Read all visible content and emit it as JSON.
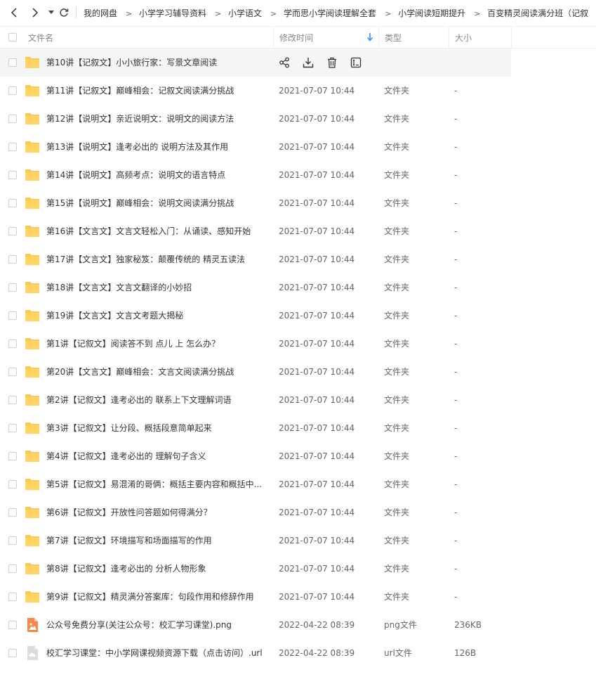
{
  "nav": {
    "breadcrumb": [
      "我的网盘",
      "小学学习辅导资料",
      "小学语文",
      "学而思小学阅读理解全套",
      "小学阅读短期提升",
      "百变精灵阅读满分班（记叙"
    ]
  },
  "columns": {
    "name": "文件名",
    "modified": "修改时间",
    "type": "类型",
    "size": "大小"
  },
  "colors": {
    "folder": "#FFC94D",
    "accent": "#3B8CFF"
  },
  "files": [
    {
      "icon": "folder-icon",
      "name": "第10讲【记叙文】小小旅行家：写景文章阅读",
      "time": "",
      "type": "",
      "size": "",
      "hover": true
    },
    {
      "icon": "folder-icon",
      "name": "第11讲【记叙文】巅峰相会：记叙文阅读满分挑战",
      "time": "2021-07-07 10:44",
      "type": "文件夹",
      "size": "-"
    },
    {
      "icon": "folder-icon",
      "name": "第12讲【说明文】亲近说明文：说明文的阅读方法",
      "time": "2021-07-07 10:44",
      "type": "文件夹",
      "size": "-"
    },
    {
      "icon": "folder-icon",
      "name": "第13讲【说明文】逢考必出的 说明方法及其作用",
      "time": "2021-07-07 10:44",
      "type": "文件夹",
      "size": "-"
    },
    {
      "icon": "folder-icon",
      "name": "第14讲【说明文】高频考点：说明文的语言特点",
      "time": "2021-07-07 10:44",
      "type": "文件夹",
      "size": "-"
    },
    {
      "icon": "folder-icon",
      "name": "第15讲【说明文】巅峰相会：说明文阅读满分挑战",
      "time": "2021-07-07 10:44",
      "type": "文件夹",
      "size": "-"
    },
    {
      "icon": "folder-icon",
      "name": "第16讲【文言文】文言文轻松入门：从诵读、感知开始",
      "time": "2021-07-07 10:44",
      "type": "文件夹",
      "size": "-"
    },
    {
      "icon": "folder-icon",
      "name": "第17讲【文言文】独家秘笈：颠覆传统的 精灵五读法",
      "time": "2021-07-07 10:44",
      "type": "文件夹",
      "size": "-"
    },
    {
      "icon": "folder-icon",
      "name": "第18讲【文言文】文言文翻译的小妙招",
      "time": "2021-07-07 10:44",
      "type": "文件夹",
      "size": "-"
    },
    {
      "icon": "folder-icon",
      "name": "第19讲【文言文】文言文考题大揭秘",
      "time": "2021-07-07 10:44",
      "type": "文件夹",
      "size": "-"
    },
    {
      "icon": "folder-icon",
      "name": "第1讲【记叙文】阅读答不到 点儿 上 怎么办？",
      "time": "2021-07-07 10:44",
      "type": "文件夹",
      "size": "-"
    },
    {
      "icon": "folder-icon",
      "name": "第20讲【文言文】巅峰相会：文言文阅读满分挑战",
      "time": "2021-07-07 10:44",
      "type": "文件夹",
      "size": "-"
    },
    {
      "icon": "folder-icon",
      "name": "第2讲【记叙文】逢考必出的 联系上下文理解词语",
      "time": "2021-07-07 10:44",
      "type": "文件夹",
      "size": "-"
    },
    {
      "icon": "folder-icon",
      "name": "第3讲【记叙文】让分段、概括段意简单起来",
      "time": "2021-07-07 10:44",
      "type": "文件夹",
      "size": "-"
    },
    {
      "icon": "folder-icon",
      "name": "第4讲【记叙文】逢考必出的 理解句子含义",
      "time": "2021-07-07 10:44",
      "type": "文件夹",
      "size": "-"
    },
    {
      "icon": "folder-icon",
      "name": "第5讲【记叙文】易混淆的哥俩：概括主要内容和概括中...",
      "time": "2021-07-07 10:44",
      "type": "文件夹",
      "size": "-"
    },
    {
      "icon": "folder-icon",
      "name": "第6讲【记叙文】开放性问答题如何得满分？",
      "time": "2021-07-07 10:44",
      "type": "文件夹",
      "size": "-"
    },
    {
      "icon": "folder-icon",
      "name": "第7讲【记叙文】环境描写和场面描写的作用",
      "time": "2021-07-07 10:44",
      "type": "文件夹",
      "size": "-"
    },
    {
      "icon": "folder-icon",
      "name": "第8讲【记叙文】逢考必出的 分析人物形象",
      "time": "2021-07-07 10:44",
      "type": "文件夹",
      "size": "-"
    },
    {
      "icon": "folder-icon",
      "name": "第9讲【记叙文】精灵满分答案库：句段作用和修辞作用",
      "time": "2021-07-07 10:44",
      "type": "文件夹",
      "size": "-"
    },
    {
      "icon": "image-file-icon",
      "name": "公众号免费分享(关注公众号：校汇学习课堂).png",
      "time": "2022-04-22 08:39",
      "type": "png文件",
      "size": "236KB"
    },
    {
      "icon": "url-file-icon",
      "name": "校汇学习课堂：中小学网课视频资源下载（点击访问）.url",
      "time": "2022-04-22 08:39",
      "type": "url文件",
      "size": "126B"
    }
  ]
}
